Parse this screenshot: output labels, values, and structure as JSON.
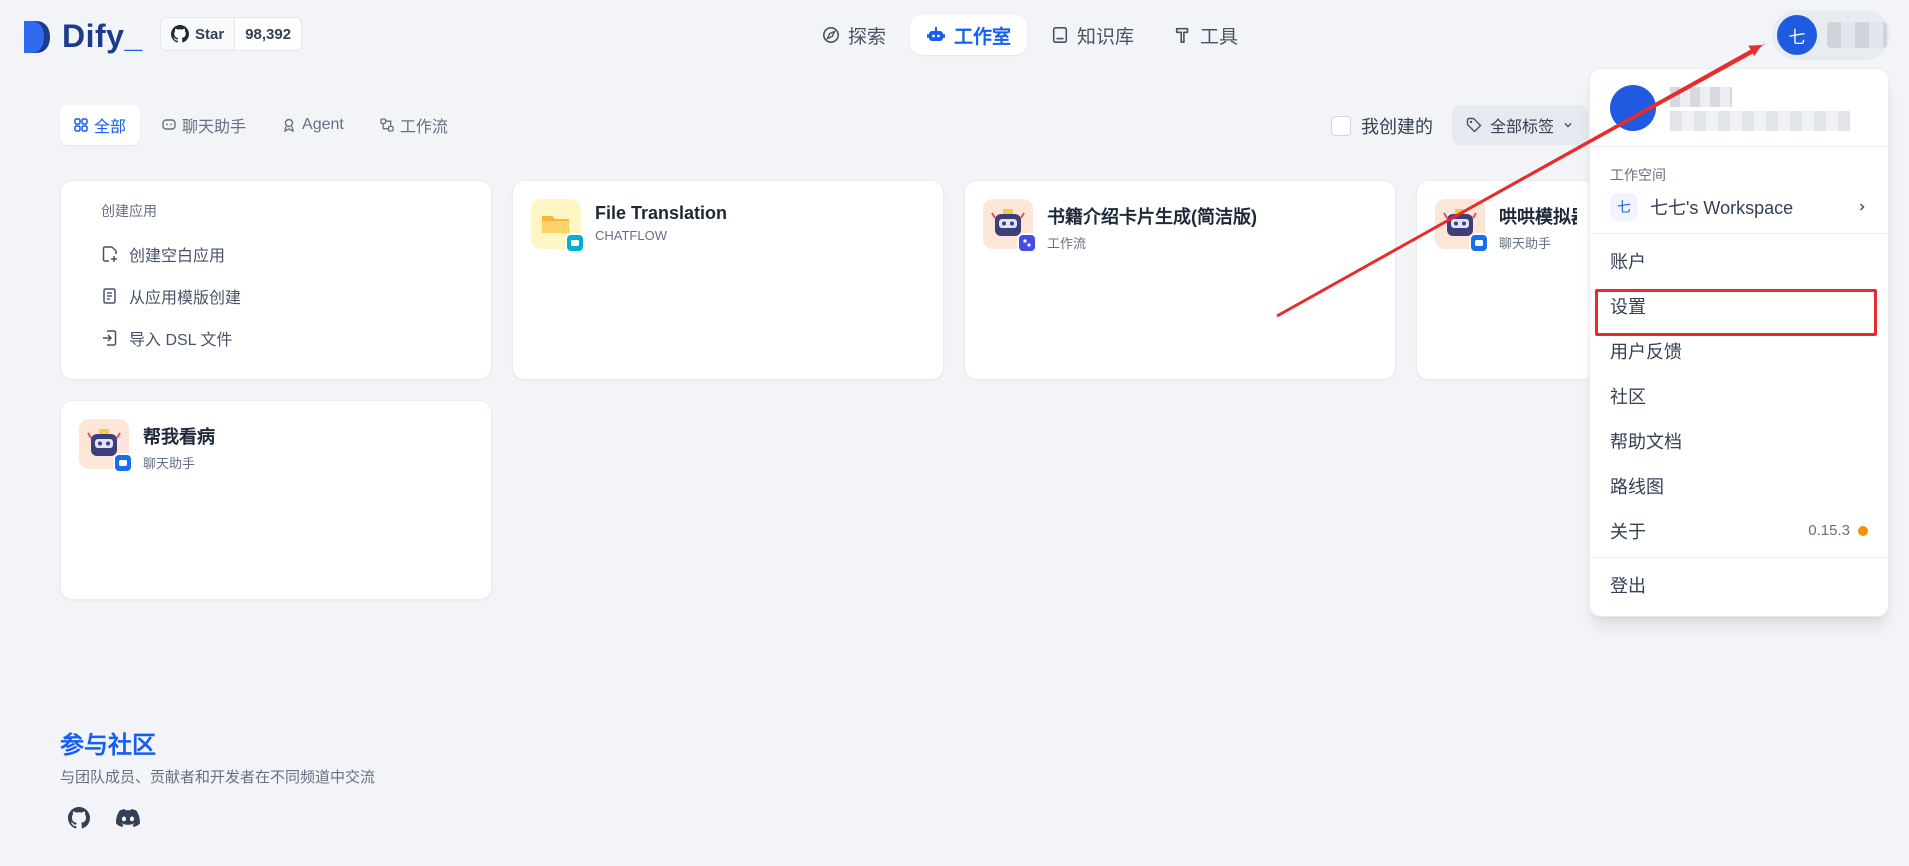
{
  "brand": {
    "name": "Dify",
    "accent": "#155eef"
  },
  "github": {
    "label": "Star",
    "count": "98,392"
  },
  "nav": [
    {
      "label": "探索",
      "icon": "compass-icon"
    },
    {
      "label": "工作室",
      "icon": "robot-icon",
      "active": true
    },
    {
      "label": "知识库",
      "icon": "book-icon"
    },
    {
      "label": "工具",
      "icon": "hammer-icon"
    }
  ],
  "user": {
    "avatar_letter": "七"
  },
  "filters": {
    "tabs": [
      {
        "label": "全部",
        "active": true
      },
      {
        "label": "聊天助手"
      },
      {
        "label": "Agent"
      },
      {
        "label": "工作流"
      }
    ],
    "mine_label": "我创建的",
    "tag_label": "全部标签"
  },
  "create": {
    "title": "创建应用",
    "items": [
      "创建空白应用",
      "从应用模版创建",
      "导入 DSL 文件"
    ]
  },
  "apps": [
    {
      "name": "File Translation",
      "type": "CHATFLOW"
    },
    {
      "name": "书籍介绍卡片生成(简洁版)",
      "type": "工作流"
    },
    {
      "name": "哄哄模拟器",
      "type": "聊天助手"
    },
    {
      "name": "帮我看病",
      "type": "聊天助手"
    }
  ],
  "community": {
    "title": "参与社区",
    "subtitle": "与团队成员、贡献者和开发者在不同频道中交流"
  },
  "dropdown": {
    "workspace_title": "工作空间",
    "workspace_initial": "七",
    "workspace_name": "七七's Workspace",
    "items": [
      "账户",
      "设置",
      "用户反馈",
      "社区",
      "帮助文档",
      "路线图",
      "关于"
    ],
    "version": "0.15.3",
    "logout": "登出"
  },
  "colors": {
    "highlight": "#e62c2c",
    "status_dot": "#f79009"
  }
}
